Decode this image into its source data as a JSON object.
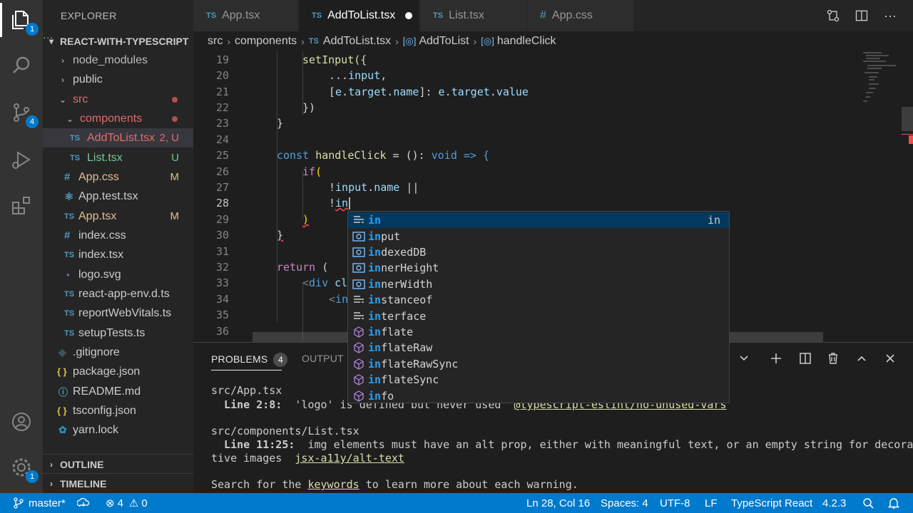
{
  "activity": {
    "explorer_badge": "1",
    "scm_badge": "4",
    "settings_badge": "1"
  },
  "sidebar": {
    "title": "EXPLORER",
    "more": "···",
    "project": "REACT-WITH-TYPESCRIPT",
    "items": [
      {
        "label": "node_modules"
      },
      {
        "label": "public"
      },
      {
        "label": "src"
      },
      {
        "label": "components"
      },
      {
        "label": "AddToList.tsx",
        "status": "2, U"
      },
      {
        "label": "List.tsx",
        "status": "U"
      },
      {
        "label": "App.css",
        "status": "M"
      },
      {
        "label": "App.test.tsx"
      },
      {
        "label": "App.tsx",
        "status": "M"
      },
      {
        "label": "index.css"
      },
      {
        "label": "index.tsx"
      },
      {
        "label": "logo.svg"
      },
      {
        "label": "react-app-env.d.ts"
      },
      {
        "label": "reportWebVitals.ts"
      },
      {
        "label": "setupTests.ts"
      },
      {
        "label": ".gitignore"
      },
      {
        "label": "package.json"
      },
      {
        "label": "README.md"
      },
      {
        "label": "tsconfig.json"
      },
      {
        "label": "yarn.lock"
      }
    ],
    "outline": "OUTLINE",
    "timeline": "TIMELINE"
  },
  "icons": {
    "ts": "TS",
    "hash": "#",
    "braces": "{ }"
  },
  "tabs": [
    {
      "label": "App.tsx"
    },
    {
      "label": "AddToList.tsx"
    },
    {
      "label": "List.tsx"
    },
    {
      "label": "App.css"
    }
  ],
  "breadcrumb": [
    "src",
    "components",
    "AddToList.tsx",
    "AddToList",
    "handleClick"
  ],
  "editor": {
    "line_numbers": [
      "19",
      "20",
      "21",
      "22",
      "23",
      "24",
      "25",
      "26",
      "27",
      "28",
      "29",
      "30",
      "31",
      "32",
      "33",
      "34",
      "35",
      "36"
    ],
    "lines": {
      "l19": "setInput({",
      "l20a": "...",
      "l20b": "input",
      "l20c": ",",
      "l21a": "[",
      "l21b": "e",
      "l21c": ".",
      "l21d": "target",
      "l21e": ".",
      "l21f": "name",
      "l21g": "]: ",
      "l21h": "e",
      "l21i": ".",
      "l21j": "target",
      "l21k": ".",
      "l21l": "value",
      "l22": "})",
      "l23": "}",
      "l25a": "const",
      "l25b": "handleClick",
      "l25c": " = (): ",
      "l25d": "void",
      "l25e": " => {",
      "l26a": "if",
      "l26b": "(",
      "l27a": "!",
      "l27b": "input",
      "l27c": ".",
      "l27d": "name",
      "l27e": " ||",
      "l28a": "!",
      "l28b": "in",
      "l29": ")",
      "l30": "}",
      "l32a": "return",
      "l32b": " (",
      "l33a": "<",
      "l33b": "div",
      "l33c": " cl",
      "l34a": "<",
      "l34b": "in"
    }
  },
  "suggest": {
    "typed": "in",
    "items": [
      {
        "rest": "",
        "kind": "keyword",
        "detail": "in"
      },
      {
        "rest": "put",
        "kind": "variable"
      },
      {
        "rest": "dexedDB",
        "kind": "variable"
      },
      {
        "rest": "nerHeight",
        "kind": "variable"
      },
      {
        "rest": "nerWidth",
        "kind": "variable"
      },
      {
        "rest": "stanceof",
        "kind": "keyword"
      },
      {
        "rest": "terface",
        "kind": "keyword"
      },
      {
        "rest": "flate",
        "kind": "module"
      },
      {
        "rest": "flateRaw",
        "kind": "module"
      },
      {
        "rest": "flateRawSync",
        "kind": "module"
      },
      {
        "rest": "flateSync",
        "kind": "module"
      },
      {
        "rest": "fo",
        "kind": "module"
      }
    ]
  },
  "panel": {
    "tab_problems": "PROBLEMS",
    "problems_count": "4",
    "tab_output": "OUTPUT",
    "file1": "src/App.tsx",
    "msg1a": "  Line 2:8:  ",
    "msg1b": "'logo' is defined but never used  ",
    "msg1c": "@typescript-eslint/no-unused-vars",
    "file2": "src/components/List.tsx",
    "msg2a": "  Line 11:25:  ",
    "msg2b": "img elements must have an alt prop, either with meaningful text, or an empty string for decora",
    "msg2c": "tive images  ",
    "msg2d": "jsx-a11y/alt-text",
    "hint_a": "Search for the ",
    "hint_b": "keywords",
    "hint_c": " to learn more about each warning."
  },
  "status": {
    "branch": "master*",
    "errors": "4",
    "warnings": "0",
    "position": "Ln 28, Col 16",
    "spaces": "Spaces: 4",
    "encoding": "UTF-8",
    "eol": "LF",
    "language": "TypeScript React",
    "version": "4.2.3"
  }
}
